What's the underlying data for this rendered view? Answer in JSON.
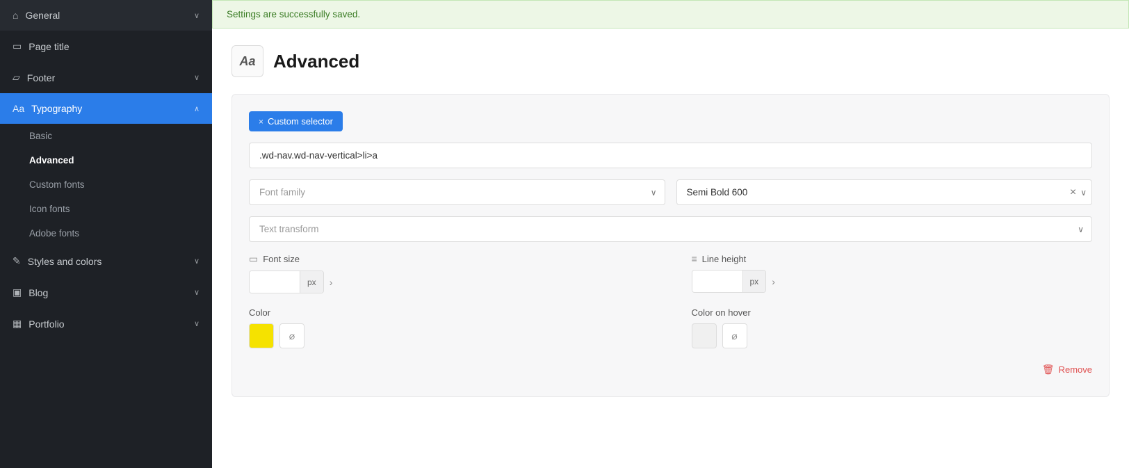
{
  "sidebar": {
    "items": [
      {
        "id": "general",
        "label": "General",
        "icon": "⌂",
        "hasChevron": true,
        "active": false
      },
      {
        "id": "page-title",
        "label": "Page title",
        "icon": "▭",
        "hasChevron": false,
        "active": false
      },
      {
        "id": "footer",
        "label": "Footer",
        "icon": "▱",
        "hasChevron": true,
        "active": false
      },
      {
        "id": "typography",
        "label": "Typography",
        "icon": "Aa",
        "hasChevron": true,
        "active": true
      }
    ],
    "typography_sub": [
      {
        "id": "basic",
        "label": "Basic",
        "active": false
      },
      {
        "id": "advanced",
        "label": "Advanced",
        "active": true
      },
      {
        "id": "custom-fonts",
        "label": "Custom fonts",
        "active": false
      },
      {
        "id": "icon-fonts",
        "label": "Icon fonts",
        "active": false
      },
      {
        "id": "adobe-fonts",
        "label": "Adobe fonts",
        "active": false
      }
    ],
    "items2": [
      {
        "id": "styles-colors",
        "label": "Styles and colors",
        "icon": "✎",
        "hasChevron": true
      },
      {
        "id": "blog",
        "label": "Blog",
        "icon": "▣",
        "hasChevron": true
      },
      {
        "id": "portfolio",
        "label": "Portfolio",
        "icon": "▦",
        "hasChevron": true
      }
    ]
  },
  "banner": {
    "text": "Settings are successfully saved."
  },
  "page": {
    "icon": "Aa",
    "title": "Advanced"
  },
  "card": {
    "selector_tag": "× Custom selector",
    "selector_tag_x": "×",
    "selector_tag_label": "Custom selector",
    "css_selector_value": ".wd-nav.wd-nav-vertical>li>a",
    "css_selector_placeholder": ".wd-nav.wd-nav-vertical>li>a",
    "font_family_placeholder": "Font family",
    "font_weight_value": "Semi Bold 600",
    "text_transform_placeholder": "Text transform",
    "font_size_label": "Font size",
    "font_size_unit": "px",
    "line_height_label": "Line height",
    "line_height_unit": "px",
    "color_label": "Color",
    "color_hover_label": "Color on hover",
    "remove_label": "Remove"
  }
}
